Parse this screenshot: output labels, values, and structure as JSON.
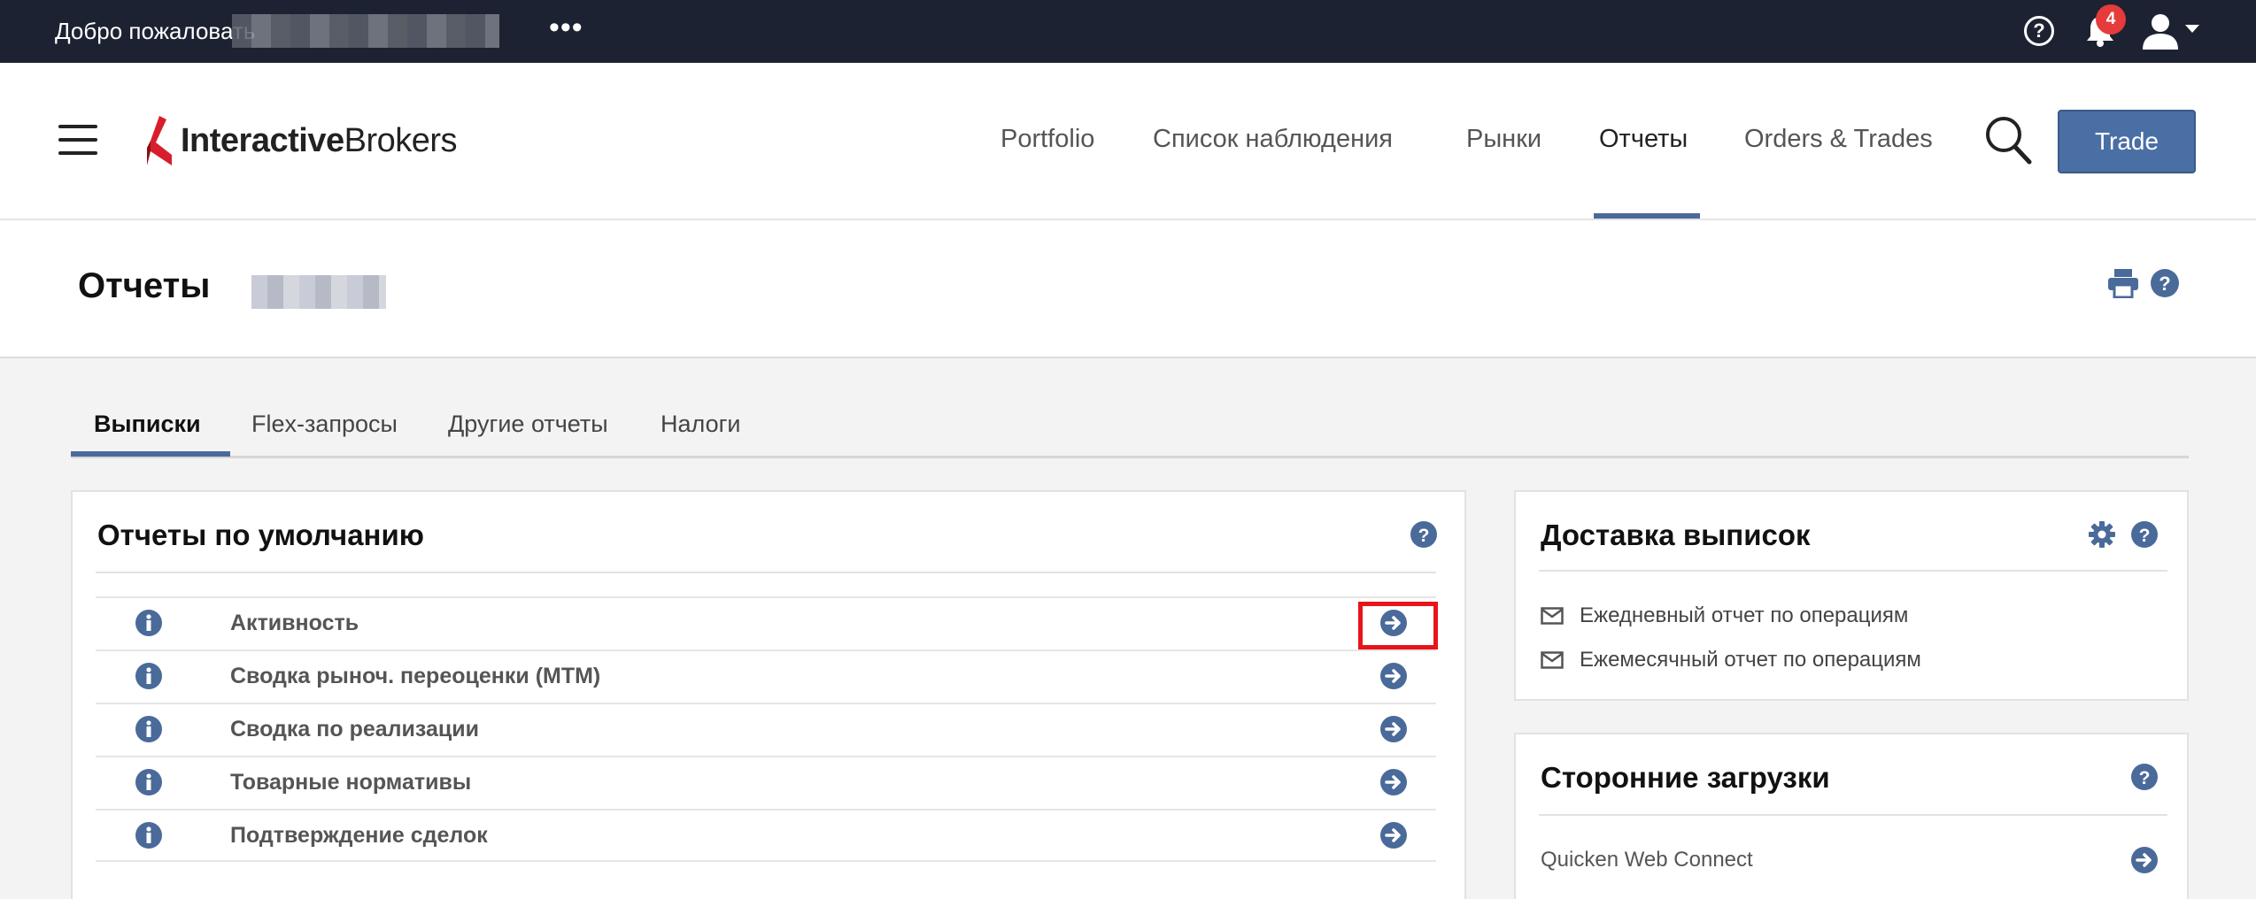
{
  "topbar": {
    "welcome": "Добро пожаловать",
    "more": "•••",
    "help": "?",
    "notifications_count": "4"
  },
  "header": {
    "logo_bold": "Interactive",
    "logo_regular": "Brokers",
    "nav": [
      "Portfolio",
      "Список наблюдения",
      "Рынки",
      "Отчеты",
      "Orders & Trades"
    ],
    "active_nav": "Отчеты",
    "trade_label": "Trade"
  },
  "page": {
    "title": "Отчеты"
  },
  "tabs": [
    "Выписки",
    "Flex-запросы",
    "Другие отчеты",
    "Налоги"
  ],
  "default_reports": {
    "title": "Отчеты по умолчанию",
    "rows": [
      "Активность",
      "Сводка рыноч. переоценки (MTM)",
      "Сводка по реализации",
      "Товарные нормативы",
      "Подтверждение сделок"
    ]
  },
  "delivery": {
    "title": "Доставка выписок",
    "items": [
      "Ежедневный отчет по операциям",
      "Ежемесячный отчет по операциям"
    ]
  },
  "third_party": {
    "title": "Сторонние загрузки",
    "items": [
      "Quicken Web Connect"
    ]
  },
  "colors": {
    "topbar": "#1c2231",
    "accent": "#4a6a9a",
    "trade_button": "#4a6fa5",
    "highlight": "#e8141a",
    "logo_red": "#d81e2c"
  }
}
